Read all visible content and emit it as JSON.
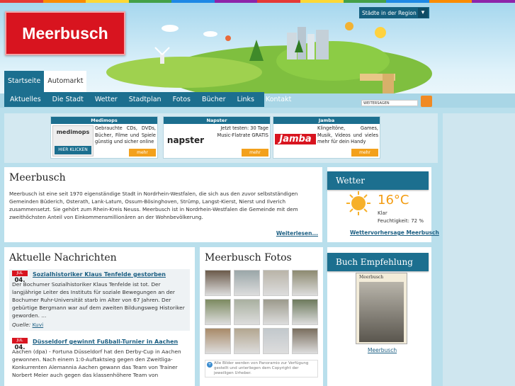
{
  "colors": {
    "accent": "#1c6f8f",
    "logo": "#d8141f",
    "link": "#1c5f83",
    "mehr": "#f3a11c",
    "stripe": [
      "#e53935",
      "#fb8c00",
      "#fdd835",
      "#43a047",
      "#1e88e5",
      "#8e24aa",
      "#e53935",
      "#fdd835",
      "#43a047",
      "#1e88e5",
      "#fb8c00",
      "#8e24aa"
    ]
  },
  "header": {
    "logo": "Meerbusch",
    "region_label": "Städte in der Region",
    "region_icon": "chevron-down-icon"
  },
  "tabs": [
    {
      "label": "Startseite",
      "active": true
    },
    {
      "label": "Automarkt",
      "active": false
    }
  ],
  "nav": [
    "Aktuelles",
    "Die Stadt",
    "Wetter",
    "Stadtplan",
    "Fotos",
    "Bücher",
    "Links",
    "Kontakt"
  ],
  "share": {
    "label": "WEITERSAGEN"
  },
  "ads": [
    {
      "title": "Medimops",
      "logo": "medimops",
      "button": "HIER KLICKEN",
      "text": "Gebrauchte CDs, DVDs, Bücher, Filme und Spiele günstig und sicher online",
      "more": "mehr"
    },
    {
      "title": "Napster",
      "logo": "napster",
      "text": "Jetzt testen: 30 Tage Music-Flatrate GRATIS",
      "more": "mehr"
    },
    {
      "title": "Jamba",
      "logo": "Jamba",
      "text": "Klingeltöne, Games, Musik, Videos und vieles mehr für dein Handy",
      "more": "mehr"
    }
  ],
  "intro": {
    "title": "Meerbusch",
    "text": "Meerbusch ist eine seit 1970 eigenständige Stadt in Nordrhein-Westfalen, die sich aus den zuvor selbstständigen Gemeinden Büderich, Osterath, Lank-Latum, Ossum-Bösinghoven, Strümp, Langst-Kierst, Nierst und Ilverich zusammensetzt. Sie gehört zum Rhein-Kreis Neuss. Meerbusch ist in Nordrhein-Westfalen die Gemeinde mit dem zweithöchsten Anteil von Einkommensmillionären an der Wohnbevölkerung.",
    "more": "Weiterlesen..."
  },
  "news": {
    "title": "Aktuelle Nachrichten",
    "items": [
      {
        "month": "JUL",
        "day": "04.",
        "title": "Sozialhistoriker Klaus Tenfelde gestorben",
        "body": "Der Bochumer Sozialhistoriker Klaus Tenfelde ist tot. Der langjährige Leiter des Instituts für soziale Bewegungen an der Bochumer Ruhr-Universität starb im Alter von 67 Jahren. Der gebürtige Bergmann war auf dem zweiten Bildungsweg Historiker geworden. ...",
        "source_label": "Quelle:",
        "source": "Kuvi"
      },
      {
        "month": "JUL",
        "day": "04.",
        "title": "Düsseldorf gewinnt Fußball-Turnier in Aachen",
        "body": "Aachen (dpa) - Fortuna Düsseldorf hat den Derby-Cup in Aachen gewonnen. Nach einem 1:0-Auftaktsieg gegen den Zweitliga-Konkurrenten Alemannia Aachen gewann das Team von Trainer Norbert Meier auch gegen das klassenhöhere Team von"
      }
    ]
  },
  "fotos": {
    "title": "Meerbusch Fotos",
    "note": "Alle Bilder werden von Panoramio zur Verfügung gestellt und unterliegen dem Copyright der jeweiligen Urheber.",
    "photos": [
      "#6b5a4a",
      "#9aa6a8",
      "#b9b4a8",
      "#8d8a70",
      "#7c8a60",
      "#a9b0a0",
      "#9c9a8c",
      "#6d7a5c",
      "#a88a68",
      "#b3a690",
      "#c2c8cc",
      "#7a6e5e"
    ]
  },
  "weather": {
    "title": "Wetter",
    "temp": "16°C",
    "condition": "Klar",
    "humidity": "Feuchtigkeit: 72 %",
    "link": "Wettervorhersage Meerbusch"
  },
  "book": {
    "title": "Buch Empfehlung",
    "cover_title": "Meerbusch",
    "link": "Meerbusch"
  }
}
